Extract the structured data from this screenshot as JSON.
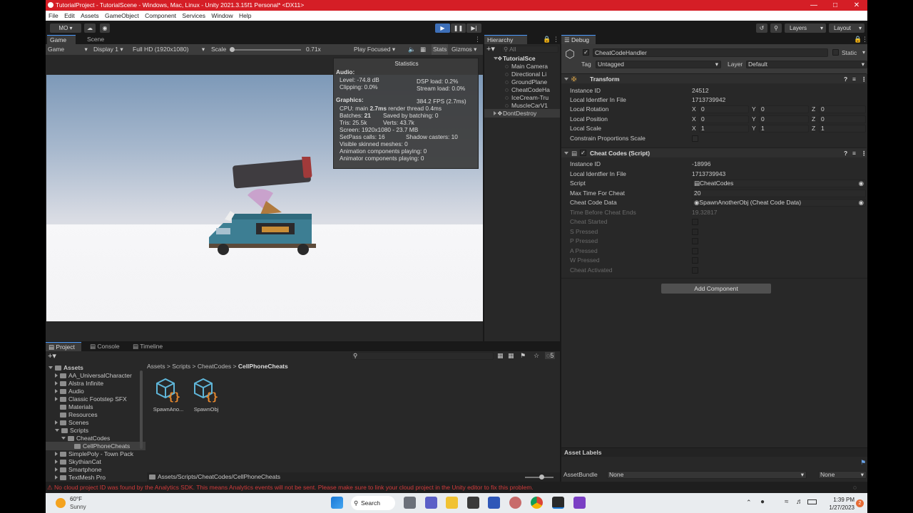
{
  "window": {
    "title": "TutorialProject - TutorialScene - Windows, Mac, Linux - Unity 2021.3.15f1 Personal* <DX11>"
  },
  "menu": [
    "File",
    "Edit",
    "Assets",
    "GameObject",
    "Component",
    "Services",
    "Window",
    "Help"
  ],
  "toolbar": {
    "account": "MO",
    "layers": "Layers",
    "layout": "Layout"
  },
  "game": {
    "tabs": [
      "Game",
      "Scene"
    ],
    "mode": "Game",
    "display": "Display 1",
    "resolution": "Full HD (1920x1080)",
    "scale_label": "Scale",
    "scale_value": "0.71x",
    "play_focused": "Play Focused",
    "stats_btn": "Stats",
    "gizmos_btn": "Gizmos"
  },
  "stats": {
    "title": "Statistics",
    "audio_header": "Audio:",
    "level": "Level: -74.8 dB",
    "dsp": "DSP load: 0.2%",
    "clipping": "Clipping: 0.0%",
    "stream": "Stream load: 0.0%",
    "graphics_header": "Graphics:",
    "fps": "384.2 FPS (2.7ms)",
    "cpu_main_label": "CPU: main",
    "cpu_main": "2.7ms",
    "render_thread": "render thread 0.4ms",
    "batches_label": "Batches:",
    "batches": "21",
    "saved_batching": "Saved by batching: 0",
    "tris": "Tris: 25.5k",
    "verts": "Verts: 43.7k",
    "screen": "Screen: 1920x1080 - 23.7 MB",
    "setpass": "SetPass calls: 16",
    "shadow": "Shadow casters: 10",
    "skinned": "Visible skinned meshes: 0",
    "anim": "Animation components playing: 0",
    "animator": "Animator components playing: 0"
  },
  "hierarchy": {
    "tab": "Hierarchy",
    "search_placeholder": "All",
    "items": [
      "TutorialSce",
      "Main Camera",
      "Directional Li",
      "GroundPlane",
      "CheatCodeHa",
      "IceCream-Tru",
      "MuscleCarV1",
      "DontDestroy"
    ]
  },
  "inspector": {
    "tab": "Debug",
    "object_name": "CheatCodeHandler",
    "static_label": "Static",
    "tag_label": "Tag",
    "tag_value": "Untagged",
    "layer_label": "Layer",
    "layer_value": "Default",
    "transform": {
      "header": "Transform",
      "instance_id_label": "Instance ID",
      "instance_id": "24512",
      "local_id_label": "Local Identfier In File",
      "local_id": "1713739942",
      "rotation_label": "Local Rotation",
      "rot": [
        "0",
        "0",
        "0"
      ],
      "position_label": "Local Position",
      "pos": [
        "0",
        "0",
        "0"
      ],
      "scale_label": "Local Scale",
      "scale": [
        "1",
        "1",
        "1"
      ],
      "constrain_label": "Constrain Proportions Scale",
      "axes": [
        "X",
        "Y",
        "Z"
      ]
    },
    "cheat": {
      "header": "Cheat Codes (Script)",
      "instance_id_label": "Instance ID",
      "instance_id": "-18996",
      "local_id_label": "Local Identfier In File",
      "local_id": "1713739943",
      "script_label": "Script",
      "script": "CheatCodes",
      "max_time_label": "Max Time For Cheat",
      "max_time": "20",
      "data_label": "Cheat Code Data",
      "data": "SpawnAnotherObj (Cheat Code Data)",
      "time_before_label": "Time Before Cheat Ends",
      "time_before": "19.32817",
      "started_label": "Cheat Started",
      "s_label": "S Pressed",
      "p_label": "P Pressed",
      "a_label": "A Pressed",
      "w_label": "W Pressed",
      "activated_label": "Cheat Activated"
    },
    "add_component": "Add Component",
    "asset_labels": "Asset Labels",
    "asset_bundle_label": "AssetBundle",
    "asset_bundle": "None",
    "asset_variant": "None"
  },
  "project": {
    "tabs": [
      "Project",
      "Console",
      "Timeline"
    ],
    "tree_root": "Assets",
    "tree": [
      "AA_UniversalCharacter",
      "Alstra Infinite",
      "Audio",
      "Classic Footstep SFX",
      "Materials",
      "Resources",
      "Scenes",
      "Scripts",
      "CheatCodes",
      "CellPhoneCheats",
      "SimplePoly - Town Pack",
      "SkythianCat",
      "Smartphone",
      "TextMesh Pro"
    ],
    "breadcrumb": [
      "Assets",
      "Scripts",
      "CheatCodes",
      "CellPhoneCheats"
    ],
    "assets": [
      "SpawnAno...",
      "SpawnObj"
    ],
    "path": "Assets/Scripts/CheatCodes/CellPhoneCheats",
    "count": "5"
  },
  "status": {
    "message": "No cloud project ID was found by the Analytics SDK. This means Analytics events will not be sent. Please make sure to link your cloud project in the Unity editor to fix this problem."
  },
  "taskbar": {
    "temp": "60°F",
    "weather": "Sunny",
    "search": "Search",
    "time": "1:39 PM",
    "date": "1/27/2023",
    "badge": "2"
  },
  "colors": {
    "title_bar": "#d51e26",
    "editor_bg": "#282828",
    "sky": "#e9e8ee",
    "accent": "#4a9bff"
  }
}
